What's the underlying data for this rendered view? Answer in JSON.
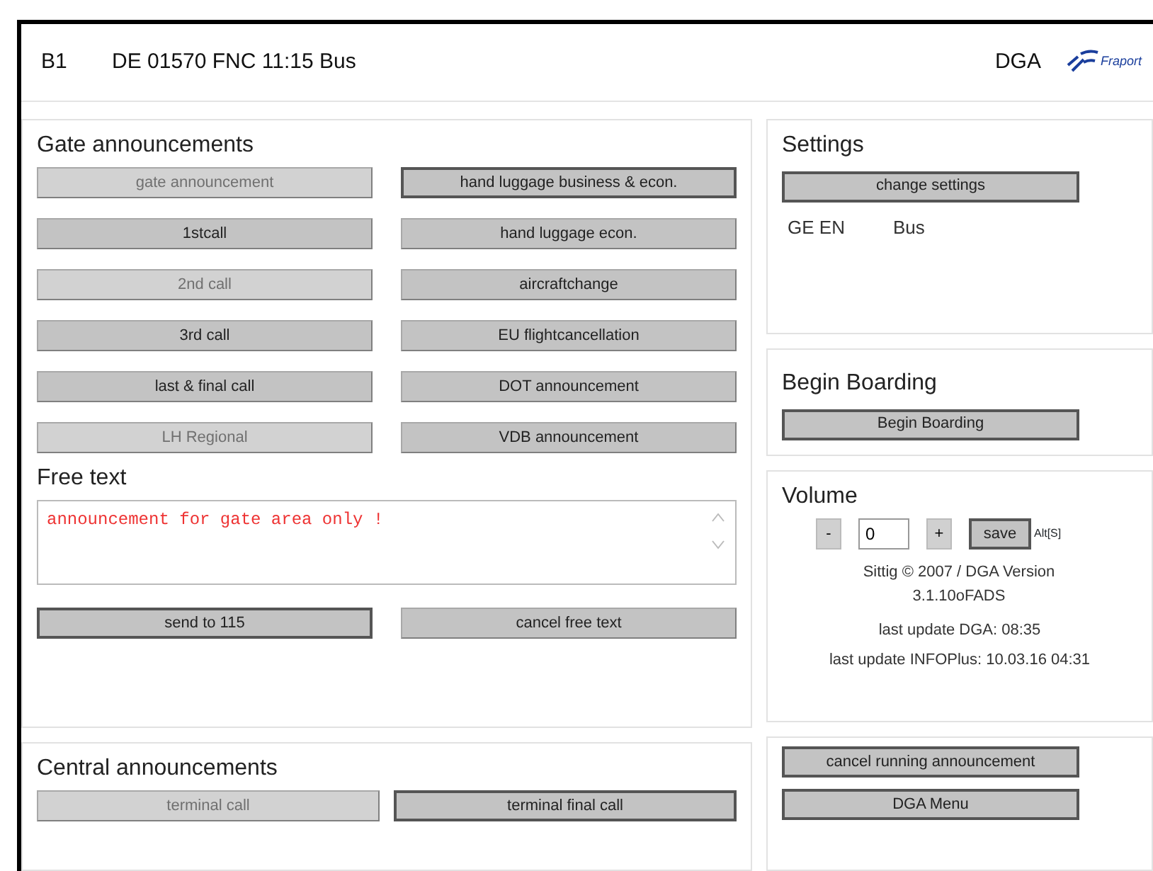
{
  "header": {
    "gate": "B1",
    "flight": "DE 01570 FNC 11:15 Bus",
    "system": "DGA",
    "logo_text": "Fraport"
  },
  "gate_announcements": {
    "title": "Gate announcements",
    "buttons": [
      {
        "label": "gate announcement",
        "disabled": true,
        "default": false
      },
      {
        "label": "hand luggage business & econ.",
        "disabled": false,
        "default": true
      },
      {
        "label": "1stcall",
        "disabled": false,
        "default": false
      },
      {
        "label": "hand luggage econ.",
        "disabled": false,
        "default": false
      },
      {
        "label": "2nd call",
        "disabled": true,
        "default": false
      },
      {
        "label": "aircraftchange",
        "disabled": false,
        "default": false
      },
      {
        "label": "3rd call",
        "disabled": false,
        "default": false
      },
      {
        "label": "EU flightcancellation",
        "disabled": false,
        "default": false
      },
      {
        "label": "last & final call",
        "disabled": false,
        "default": false
      },
      {
        "label": "DOT announcement",
        "disabled": false,
        "default": false
      },
      {
        "label": "LH Regional",
        "disabled": true,
        "default": false
      },
      {
        "label": "VDB announcement",
        "disabled": false,
        "default": false
      }
    ]
  },
  "free_text": {
    "title": "Free text",
    "value": "announcement for gate area only !",
    "buttons": [
      {
        "label": "send to 115",
        "disabled": false,
        "default": true
      },
      {
        "label": "cancel free text",
        "disabled": false,
        "default": false
      }
    ]
  },
  "central_announcements": {
    "title": "Central announcements",
    "buttons": [
      {
        "label": "terminal call",
        "disabled": true,
        "default": false
      },
      {
        "label": "terminal final call",
        "disabled": false,
        "default": true
      }
    ]
  },
  "settings": {
    "title": "Settings",
    "button": "change settings",
    "languages": "GE EN",
    "mode": "Bus"
  },
  "begin_boarding": {
    "title": "Begin Boarding",
    "button": "Begin Boarding"
  },
  "volume": {
    "title": "Volume",
    "minus": "-",
    "value": "0",
    "plus": "+",
    "save": "save",
    "shortcut": "Alt[S]",
    "version": "Sittig © 2007 / DGA Version 3.1.10oFADS",
    "dga_update": "last update DGA: 08:35",
    "infoplus_update": "last update INFOPlus: 10.03.16 04:31"
  },
  "actions": [
    {
      "label": "cancel running announcement",
      "disabled": false,
      "default": true
    },
    {
      "label": "DGA Menu",
      "disabled": false,
      "default": true
    }
  ]
}
